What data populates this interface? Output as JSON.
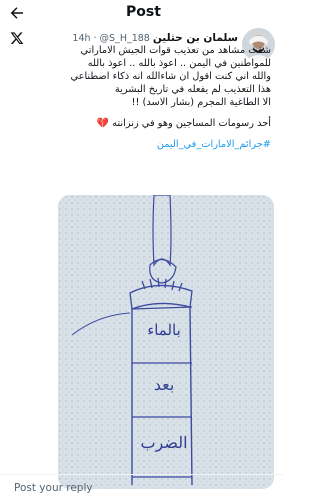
{
  "header": {
    "title": "Post",
    "back_icon": "arrow-left-icon"
  },
  "tweet": {
    "platform_icon": "x-logo-icon",
    "author_name": "سلمان بن حثلين",
    "handle": "@S_H_188",
    "separator": "·",
    "time": "14h",
    "lines": [
      "شفت مشاهد من تعذيب قوات الجيش الاماراتي",
      "للمواطنين في اليمن .. اعوذ بالله .. اعوذ بالله",
      "والله اني كنت اقول ان شاءالله انه ذكاء اصطناعي",
      "هذا التعذيب لم يفعله في تاريخ البشرية",
      "الا الطاغية المجرم (بشار الاسد) !!"
    ],
    "second_paragraph": "أحد رسومات المساجين وهو في زنزانته 💔",
    "hashtag": "#جرائم_الامارات_في_اليمن",
    "media_text": [
      "بالماء",
      "بعد",
      "الضرب"
    ]
  },
  "reply": {
    "placeholder": "Post your reply"
  },
  "colors": {
    "accent": "#1d9bf0",
    "text": "#0f1419",
    "secondary": "#536471"
  }
}
